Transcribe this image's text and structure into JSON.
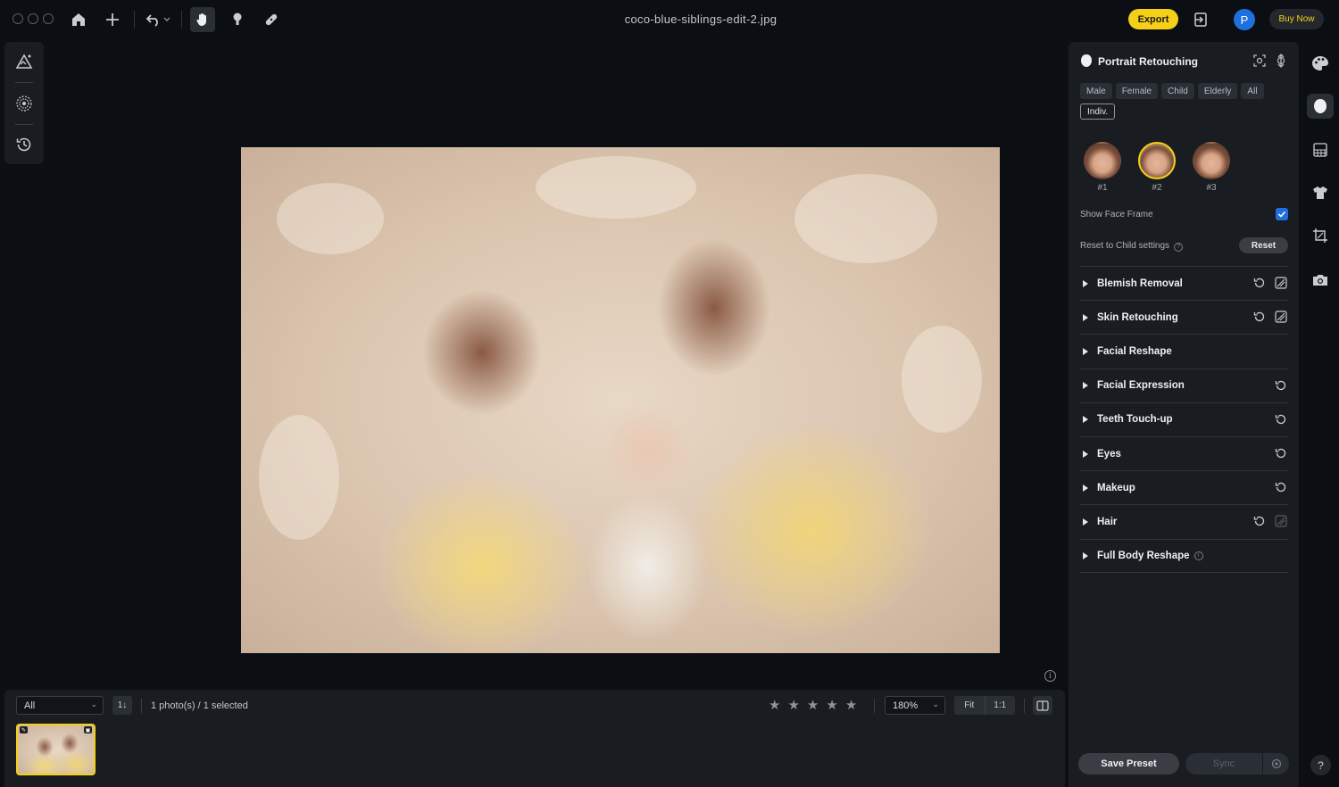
{
  "titlebar": {
    "file_name": "coco-blue-siblings-edit-2.jpg",
    "export_label": "Export",
    "avatar_initial": "P",
    "buy_now_label": "Buy Now",
    "tools": [
      "home-icon",
      "add-icon",
      "undo-icon",
      "hand-icon",
      "stamp-icon",
      "bandage-icon"
    ]
  },
  "left_tools": [
    "adjust-icon",
    "texture-icon",
    "history-icon"
  ],
  "bottom_bar": {
    "filter_value": "All",
    "sort_label": "1↓",
    "count_text": "1 photo(s) / 1 selected",
    "rating_stars": 5,
    "zoom_value": "180%",
    "fit_label": "Fit",
    "one_to_one_label": "1:1"
  },
  "panel": {
    "title": "Portrait Retouching",
    "chips": [
      {
        "label": "Male",
        "selected": false
      },
      {
        "label": "Female",
        "selected": false
      },
      {
        "label": "Child",
        "selected": false
      },
      {
        "label": "Elderly",
        "selected": false
      },
      {
        "label": "All",
        "selected": false
      },
      {
        "label": "Indiv.",
        "selected": true
      }
    ],
    "faces": [
      {
        "label": "#1",
        "active": false
      },
      {
        "label": "#2",
        "active": true
      },
      {
        "label": "#3",
        "active": false
      }
    ],
    "show_face_frame_label": "Show Face Frame",
    "show_face_frame_checked": true,
    "reset_label": "Reset to Child settings",
    "reset_button": "Reset",
    "sections": [
      {
        "label": "Blemish Removal",
        "reset": true,
        "erase": true,
        "erase_dim": false
      },
      {
        "label": "Skin Retouching",
        "reset": true,
        "erase": true,
        "erase_dim": false
      },
      {
        "label": "Facial Reshape",
        "reset": false,
        "erase": false,
        "erase_dim": false
      },
      {
        "label": "Facial Expression",
        "reset": true,
        "erase": false,
        "erase_dim": false
      },
      {
        "label": "Teeth Touch-up",
        "reset": true,
        "erase": false,
        "erase_dim": false
      },
      {
        "label": "Eyes",
        "reset": true,
        "erase": false,
        "erase_dim": false
      },
      {
        "label": "Makeup",
        "reset": true,
        "erase": false,
        "erase_dim": false
      },
      {
        "label": "Hair",
        "reset": true,
        "erase": true,
        "erase_dim": true
      },
      {
        "label": "Full Body Reshape",
        "reset": false,
        "erase": false,
        "erase_dim": false,
        "info": true
      }
    ],
    "save_preset_label": "Save Preset",
    "sync_label": "Sync"
  },
  "right_strip": [
    "palette-icon",
    "face-icon",
    "grid-icon",
    "shirt-icon",
    "crop-icon",
    "camera-icon"
  ],
  "help_label": "?",
  "colors": {
    "accent": "#f5d018",
    "checkbox": "#1f6fe0",
    "background": "#0b0e12",
    "panel": "#191c21"
  }
}
